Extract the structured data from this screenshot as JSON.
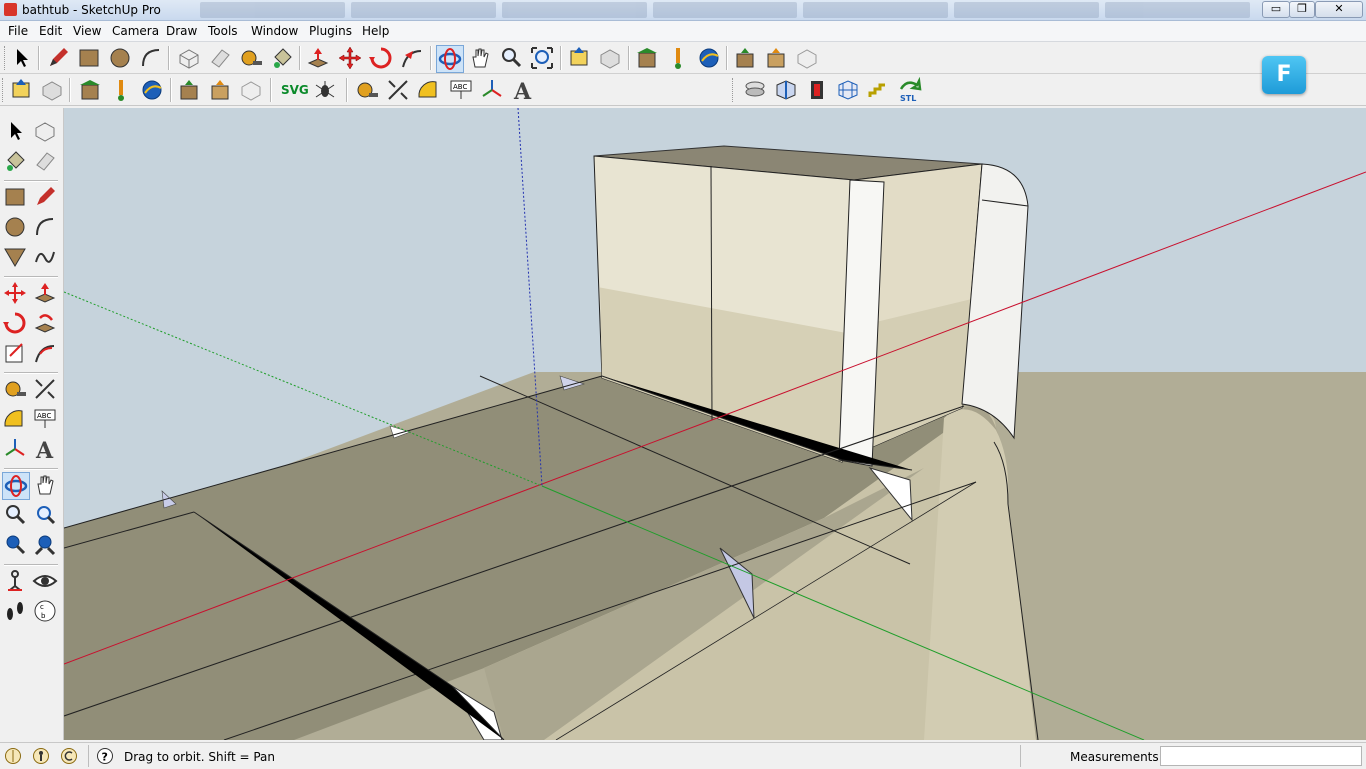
{
  "window": {
    "title": "bathtub - SketchUp Pro",
    "minimize_label": "▭",
    "maximize_label": "❐",
    "close_label": "✕"
  },
  "menu": {
    "items": [
      "File",
      "Edit",
      "View",
      "Camera",
      "Draw",
      "Tools",
      "Window",
      "Plugins",
      "Help"
    ]
  },
  "toolbar": {
    "svg_label": "SVG",
    "badge_label": "F"
  },
  "icons": {
    "top": [
      "select-icon",
      "pencil-icon",
      "rectangle-icon",
      "circle-icon",
      "arc-icon",
      "make-component-icon",
      "eraser-icon",
      "tape-measure-icon",
      "paint-bucket-icon",
      "push-pull-icon",
      "move-icon",
      "rotate-icon",
      "follow-me-icon",
      "orbit-icon",
      "pan-icon",
      "zoom-icon",
      "zoom-extents-icon",
      "import-icon",
      "export-icon",
      "3d-warehouse-icon",
      "get-models-icon",
      "google-earth-icon",
      "share-model-icon",
      "share-component-icon",
      "extension-icon"
    ],
    "left": [
      "select-icon",
      "make-component-icon",
      "paint-bucket-icon",
      "eraser-icon",
      "rectangle-icon",
      "line-icon",
      "circle-icon",
      "arc-icon",
      "polygon-icon",
      "freehand-icon",
      "move-icon",
      "push-pull-icon",
      "rotate-icon",
      "follow-me-icon",
      "scale-icon",
      "offset-icon",
      "tape-measure-icon",
      "dimension-icon",
      "protractor-icon",
      "text-icon",
      "axes-icon",
      "3d-text-icon",
      "orbit-icon",
      "pan-icon",
      "zoom-icon",
      "zoom-window-icon",
      "zoom-extents-icon",
      "previous-view-icon",
      "position-camera-icon",
      "look-around-icon",
      "walk-icon",
      "section-plane-icon"
    ]
  },
  "colors": {
    "sky": "#c6d3dc",
    "ground": "#a39f88",
    "box_face": "#e8e4d2",
    "box_shade": "#d6d0b6",
    "box_top": "#8b8674",
    "tub_top": "#9a9580",
    "tub_curve": "#c9c3a8",
    "red_axis": "#c8102e",
    "green_axis": "#1f9e2a",
    "blue_axis": "#2231b0"
  },
  "status": {
    "hint": "Drag to orbit.  Shift = Pan",
    "measurements_label": "Measurements",
    "measurements_value": ""
  }
}
